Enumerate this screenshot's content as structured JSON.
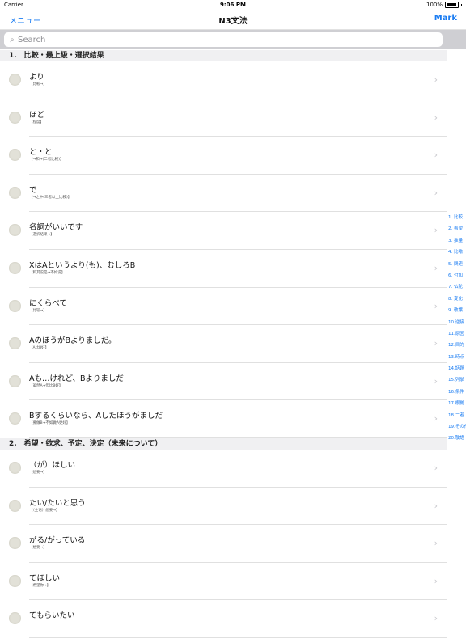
{
  "status": {
    "carrier": "Carrier",
    "time": "9:06 PM",
    "battery": "100%"
  },
  "nav": {
    "left": "メニュー",
    "title": "N3文法",
    "right": "Mark"
  },
  "search": {
    "placeholder": "Search"
  },
  "sections": [
    {
      "header": "1.　比較・最上級・選択結果",
      "rows": [
        {
          "title": "より",
          "sub": "【比較→】"
        },
        {
          "title": "ほど",
          "sub": "【程度】"
        },
        {
          "title": "と・と",
          "sub": "【→和→(二者比較)】"
        },
        {
          "title": "で",
          "sub": "【→之中(三者以上比較)】"
        },
        {
          "title": "名詞がいいです",
          "sub": "【選択結果→】"
        },
        {
          "title": "XはAというより(も)、むしろB",
          "sub": "【和其说是→不如说】"
        },
        {
          "title": "にくらべて",
          "sub": "【比较→】"
        },
        {
          "title": "AのほうがBよりましだ。",
          "sub": "【A比B好】"
        },
        {
          "title": "Aも…けれど、Bよりましだ",
          "sub": "【虽然A→但比B好】"
        },
        {
          "title": "Bするくらいなら、Aしたほうがましだ",
          "sub": "【要做B→不如做A更好】"
        }
      ]
    },
    {
      "header": "2.　希望・欲求、予定、決定（未来について）",
      "rows": [
        {
          "title": "（が）ほしい",
          "sub": "【想要→】"
        },
        {
          "title": "たい/たいと思う",
          "sub": "【（主语）想要→】"
        },
        {
          "title": "がる/がっている",
          "sub": "【想要→】"
        },
        {
          "title": "てほしい",
          "sub": "【希望你→】"
        },
        {
          "title": "てもらいたい",
          "sub": ""
        }
      ]
    }
  ],
  "index": [
    "1. 比較",
    "2. 希望",
    "3. 推量",
    "4. 比喩",
    "5. 関連",
    "6. 付加",
    "7. 仏陀",
    "8. 変化",
    "9. 敬譲",
    "10.逆接",
    "11.原因",
    "12.目的",
    "13.時点",
    "14.話題",
    "15.列挙",
    "16.条件",
    "17.根拠",
    "18.二者",
    "19.その他",
    "20.敬語"
  ]
}
